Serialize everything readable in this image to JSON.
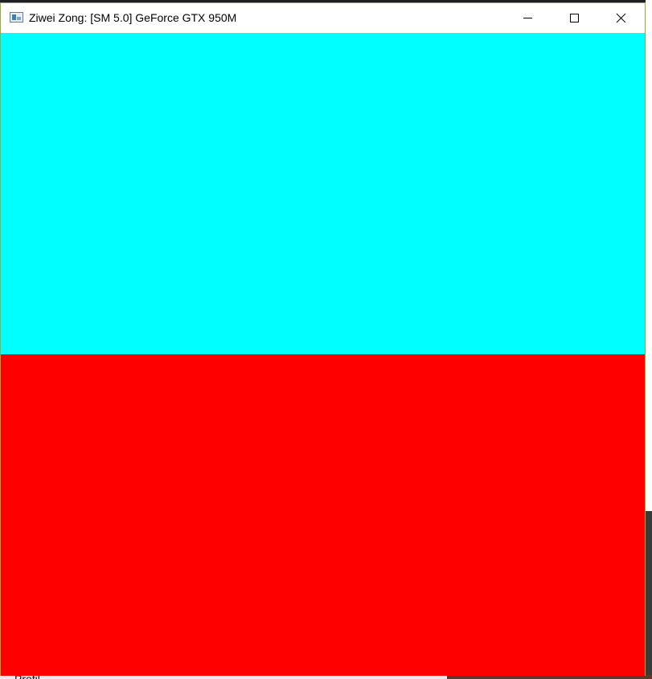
{
  "window": {
    "title": "Ziwei Zong: [SM 5.0] GeForce GTX 950M",
    "controls": {
      "minimize_icon": "minimize-icon",
      "maximize_icon": "maximize-icon",
      "close_icon": "close-icon"
    }
  },
  "canvas": {
    "top_color": "#00FFFF",
    "bottom_color": "#FF0000"
  },
  "background": {
    "partial_text": "Profil"
  }
}
